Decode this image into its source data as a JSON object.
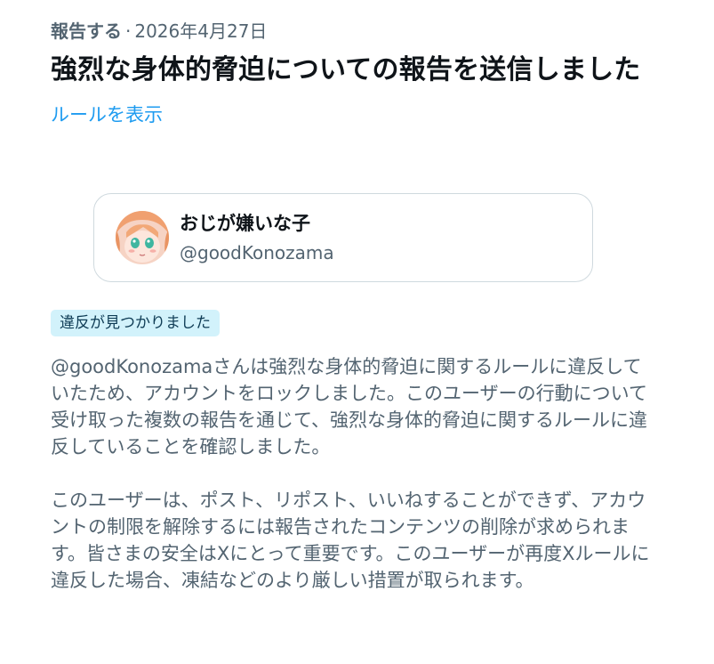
{
  "report": {
    "type_label": "報告する",
    "separator": "·",
    "date": "2026年4月27日",
    "title": "強烈な身体的脅迫についての報告を送信しました",
    "rules_link": "ルールを表示"
  },
  "user_card": {
    "display_name": "おじが嫌いな子",
    "handle": "@goodKonozama"
  },
  "status_badge": "違反が見つかりました",
  "description": {
    "paragraph1": "@goodKonozamaさんは強烈な身体的脅迫に関するルールに違反していたため、アカウントをロックしました。このユーザーの行動について受け取った複数の報告を通じて、強烈な身体的脅迫に関するルールに違反していることを確認しました。",
    "paragraph2": "このユーザーは、ポスト、リポスト、いいねすることができず、アカウントの制限を解除するには報告されたコンテンツの削除が求められます。皆さまの安全はXにとって重要です。このユーザーが再度Xルールに違反した場合、凍結などのより厳しい措置が取られます。"
  },
  "colors": {
    "primary_text": "#0f1419",
    "secondary_text": "#536471",
    "link": "#1d9bf0",
    "badge_bg": "#d2f2fb",
    "card_border": "#cfd9de"
  },
  "icons": {
    "avatar": "anime-avatar-image"
  }
}
